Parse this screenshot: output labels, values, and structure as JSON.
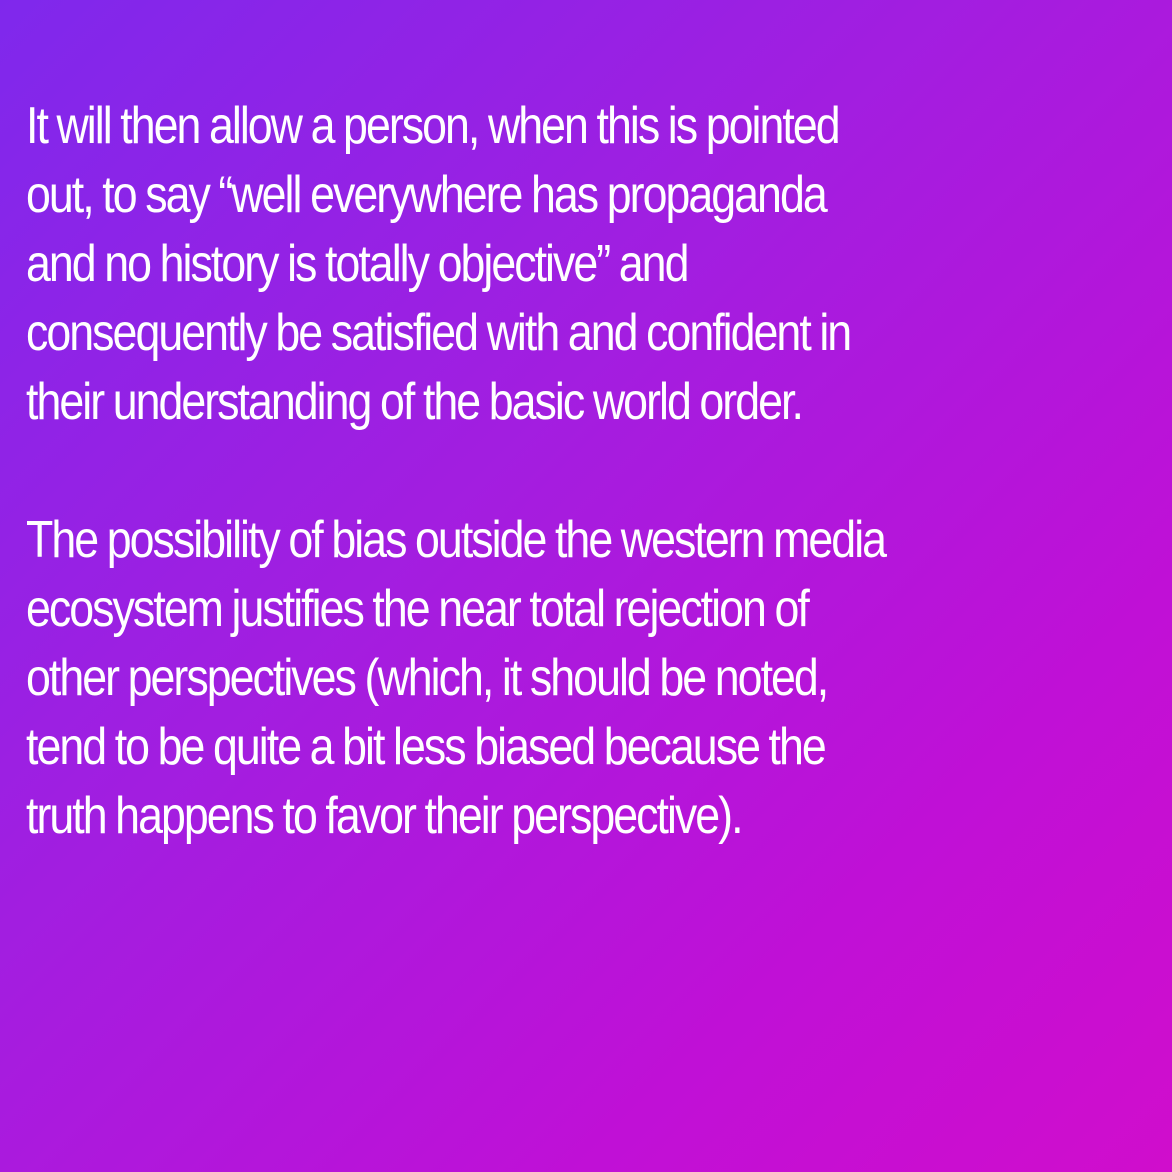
{
  "paragraphs": [
    {
      "lines": [
        "It will then allow a person, when this is pointed",
        "out, to say “well everywhere has propaganda",
        "and no history is totally objective” and",
        "consequently be satisfied with and confident in",
        "their understanding of the basic world order."
      ]
    },
    {
      "lines": [
        "The possibility of bias outside the western media",
        "ecosystem justifies the near total rejection of",
        "other perspectives (which, it should be noted,",
        "tend to be quite a bit less biased because the",
        "truth happens to favor their perspective)."
      ]
    }
  ],
  "colors": {
    "gradient_start": "#7f28ec",
    "gradient_end": "#d00dcc",
    "text": "#ffffff"
  }
}
